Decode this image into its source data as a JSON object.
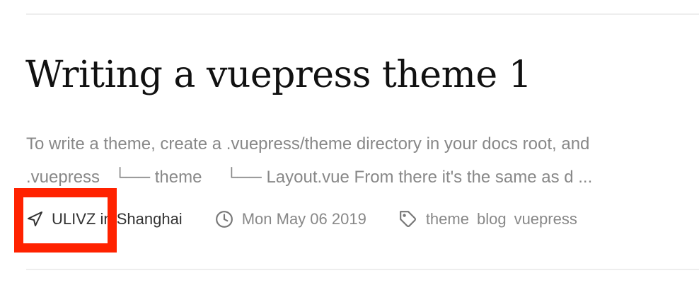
{
  "post": {
    "title": "Writing a vuepress theme 1",
    "excerpt_line1": "To write a theme, create a .vuepress/theme directory in your docs root, and",
    "excerpt_line2": ".vuepress   └── theme     └── Layout.vue From there it's the same as d ...",
    "author": "ULIVZ",
    "location": "in Shanghai",
    "date": "Mon May 06 2019",
    "tags": [
      "theme",
      "blog",
      "vuepress"
    ]
  },
  "icons": {
    "author": "navigation-icon",
    "date": "clock-icon",
    "tags": "tag-icon"
  },
  "highlight_color": "#ff2200"
}
